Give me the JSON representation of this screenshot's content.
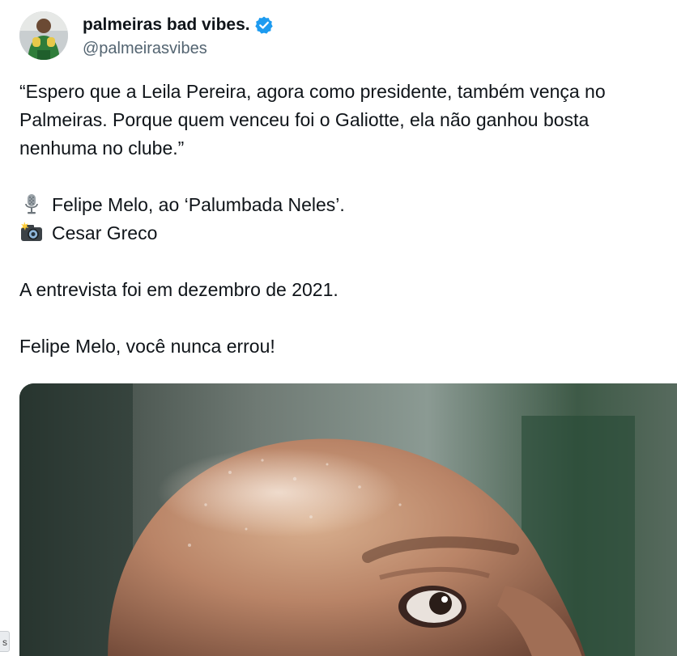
{
  "author": {
    "display_name": "palmeiras bad vibes.",
    "handle": "@palmeirasvibes",
    "avatar_icon": "profile-photo-goalkeeper",
    "verified_icon": "verified-badge-icon",
    "verified_color": "#1d9bf0"
  },
  "tweet": {
    "lines": [
      "“Espero que a Leila Pereira, agora como presidente, também vença no",
      "Palmeiras. Porque quem venceu foi o Galiotte, ela não ganhou bosta",
      "nenhuma no clube.”"
    ],
    "credit_interview": "Felipe Melo, ao ‘Palumbada Neles’.",
    "credit_photo": "Cesar Greco",
    "date_note": "A entrevista foi em dezembro de 2021.",
    "closing": "Felipe Melo, você nunca errou!"
  },
  "media": {
    "type": "photo",
    "subject": "close-up of bald man looking up"
  },
  "side_chip": {
    "label": "s"
  }
}
